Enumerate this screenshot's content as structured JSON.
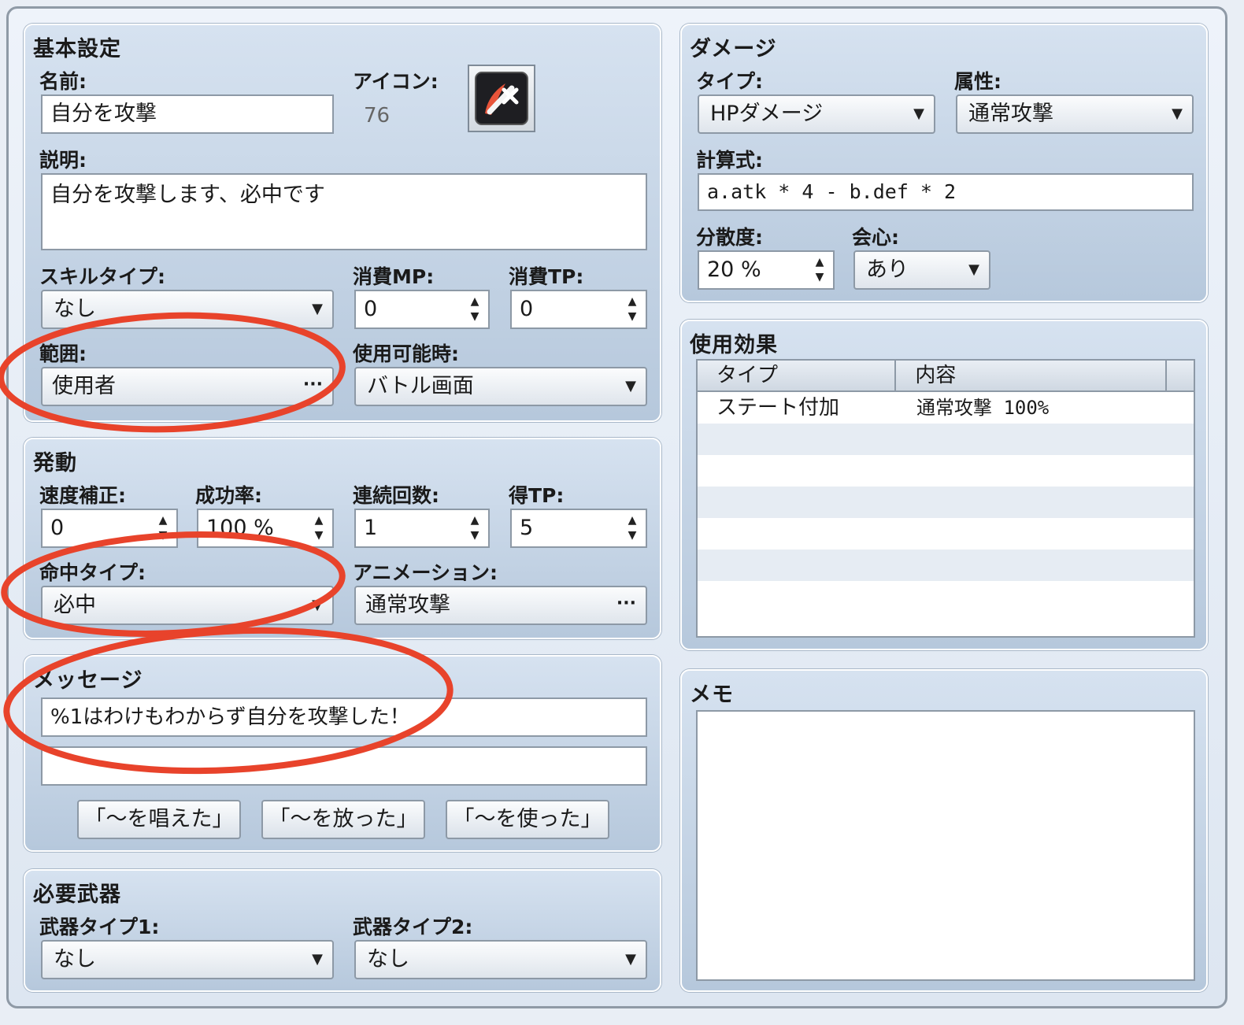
{
  "basic": {
    "title": "基本設定",
    "name_label": "名前:",
    "name_value": "自分を攻撃",
    "icon_label": "アイコン:",
    "icon_index": "76",
    "desc_label": "説明:",
    "desc_value": "自分を攻撃します、必中です",
    "skilltype_label": "スキルタイプ:",
    "skilltype_value": "なし",
    "mp_label": "消費MP:",
    "mp_value": "0",
    "tp_label": "消費TP:",
    "tp_value": "0",
    "scope_label": "範囲:",
    "scope_value": "使用者",
    "occasion_label": "使用可能時:",
    "occasion_value": "バトル画面"
  },
  "invocation": {
    "title": "発動",
    "speed_label": "速度補正:",
    "speed_value": "0",
    "success_label": "成功率:",
    "success_value": "100 %",
    "repeat_label": "連続回数:",
    "repeat_value": "1",
    "tpgain_label": "得TP:",
    "tpgain_value": "5",
    "hittype_label": "命中タイプ:",
    "hittype_value": "必中",
    "anim_label": "アニメーション:",
    "anim_value": "通常攻撃"
  },
  "message": {
    "title": "メッセージ",
    "line1": "%1はわけもわからず自分を攻撃した！",
    "line2": "",
    "btn1": "「～を唱えた」",
    "btn2": "「～を放った」",
    "btn3": "「～を使った」"
  },
  "weapons": {
    "title": "必要武器",
    "w1_label": "武器タイプ1:",
    "w1_value": "なし",
    "w2_label": "武器タイプ2:",
    "w2_value": "なし"
  },
  "damage": {
    "title": "ダメージ",
    "type_label": "タイプ:",
    "type_value": "HPダメージ",
    "elem_label": "属性:",
    "elem_value": "通常攻撃",
    "formula_label": "計算式:",
    "formula_value": "a.atk * 4 - b.def * 2",
    "variance_label": "分散度:",
    "variance_value": "20 %",
    "crit_label": "会心:",
    "crit_value": "あり"
  },
  "effects": {
    "title": "使用効果",
    "col_type": "タイプ",
    "col_content": "内容",
    "row1_type": "ステート付加",
    "row1_content": "通常攻撃 100%"
  },
  "memo": {
    "title": "メモ",
    "value": ""
  },
  "glyphs": {
    "dropdown": "▼",
    "ellipsis": "···",
    "spin": "▲\n▼"
  },
  "colors": {
    "annotation": "#e8432b"
  }
}
